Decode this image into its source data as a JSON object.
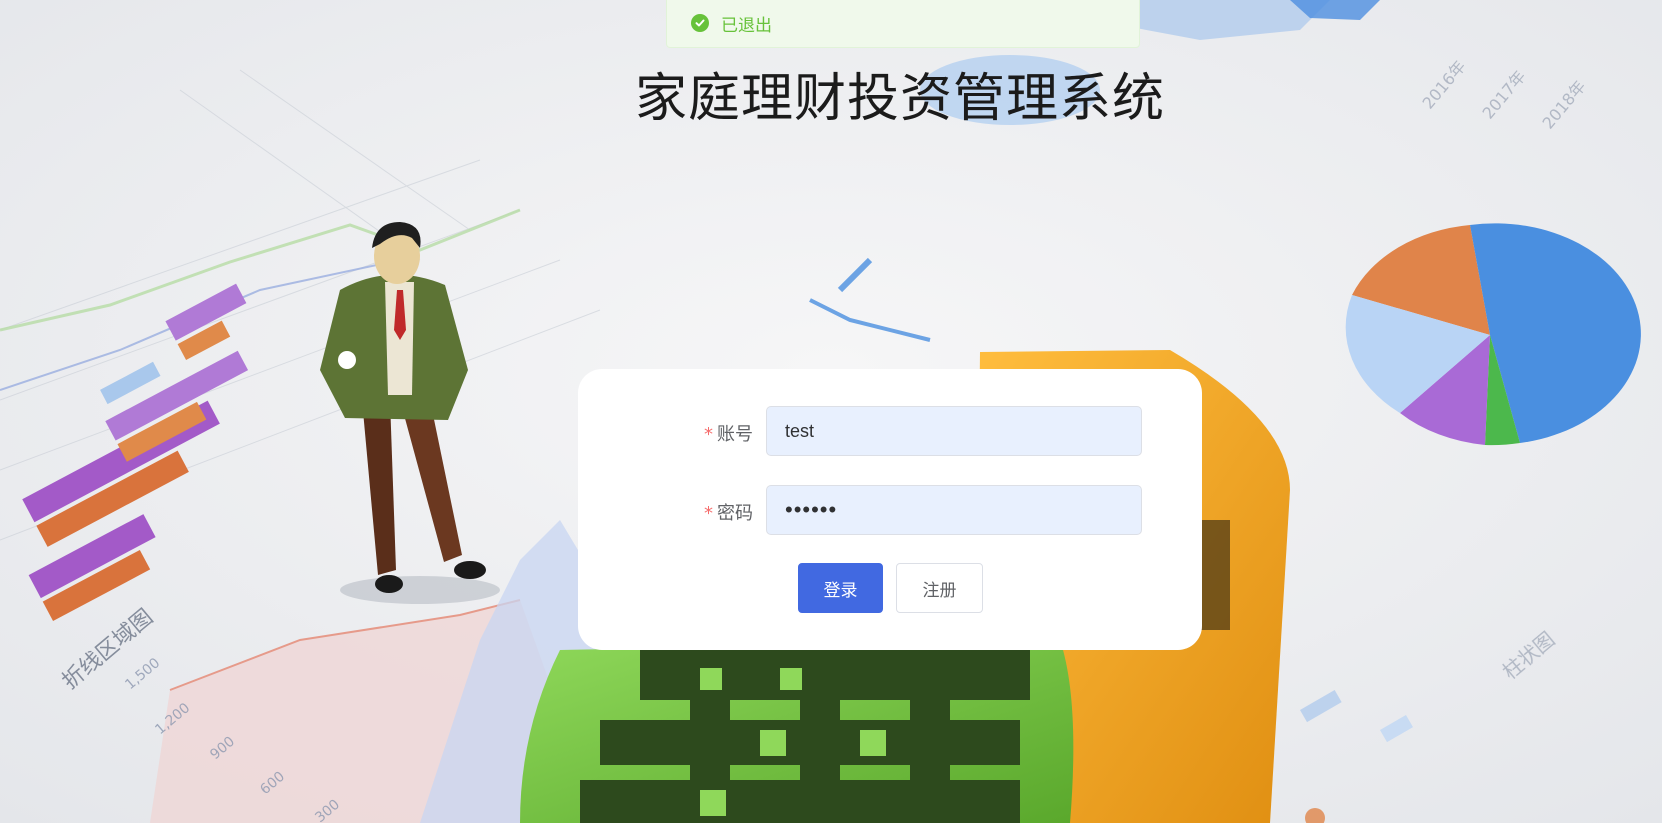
{
  "toast": {
    "message": "已退出",
    "icon": "check-circle-icon",
    "color": "#67c23a"
  },
  "title": "家庭理财投资管理系统",
  "form": {
    "account": {
      "required_mark": "*",
      "label": "账号",
      "value": "test"
    },
    "password": {
      "required_mark": "*",
      "label": "密码",
      "value": "••••••"
    },
    "login_label": "登录",
    "register_label": "注册"
  },
  "colors": {
    "primary": "#4169e1",
    "required": "#f56c6c",
    "success": "#67c23a",
    "input_bg": "#e8f0fe"
  }
}
